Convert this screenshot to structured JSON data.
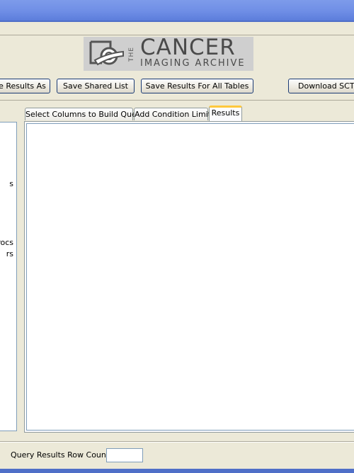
{
  "logo": {
    "the": "THE",
    "name": "CANCER",
    "subtitle": "IMAGING ARCHIVE"
  },
  "toolbar": {
    "save_results_as": "e Results As",
    "save_shared_list": "Save Shared List",
    "save_results_all_tables": "Save Results For All Tables",
    "download_sct": "Download SCT Im"
  },
  "left_panel": {
    "items": [
      {
        "label": "s"
      },
      {
        "label": "rocs"
      },
      {
        "label": "rs"
      }
    ]
  },
  "tabs": [
    {
      "label": "Select Columns to Build Query"
    },
    {
      "label": "Add Condition Limits"
    },
    {
      "label": "Results"
    }
  ],
  "active_tab": "Results",
  "footer": {
    "row_count_label": "Query Results Row Count",
    "row_count_value": ""
  }
}
